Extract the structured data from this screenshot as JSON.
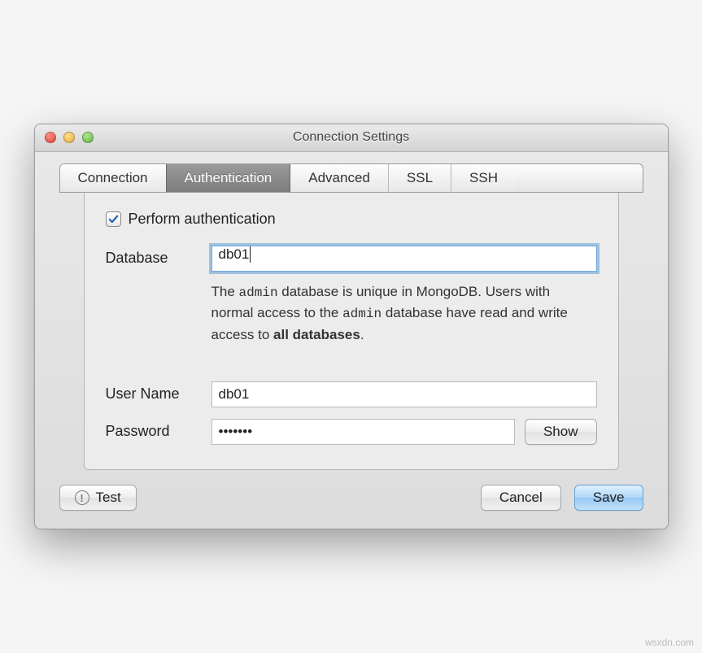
{
  "window": {
    "title": "Connection Settings"
  },
  "tabs": {
    "connection": "Connection",
    "authentication": "Authentication",
    "advanced": "Advanced",
    "ssl": "SSL",
    "ssh": "SSH",
    "active": "authentication"
  },
  "auth": {
    "perform_label": "Perform authentication",
    "perform_checked": true,
    "database_label": "Database",
    "database_value": "db01",
    "help": {
      "part1": "The ",
      "code1": "admin",
      "part2": " database is unique in MongoDB. Users with normal access to the ",
      "code2": "admin",
      "part3": " database have read and write access to ",
      "bold": "all databases",
      "part4": "."
    },
    "username_label": "User Name",
    "username_value": "db01",
    "password_label": "Password",
    "password_value": "•••••••",
    "show_label": "Show"
  },
  "footer": {
    "test_label": "Test",
    "cancel_label": "Cancel",
    "save_label": "Save"
  },
  "attribution": "wsxdn.com"
}
